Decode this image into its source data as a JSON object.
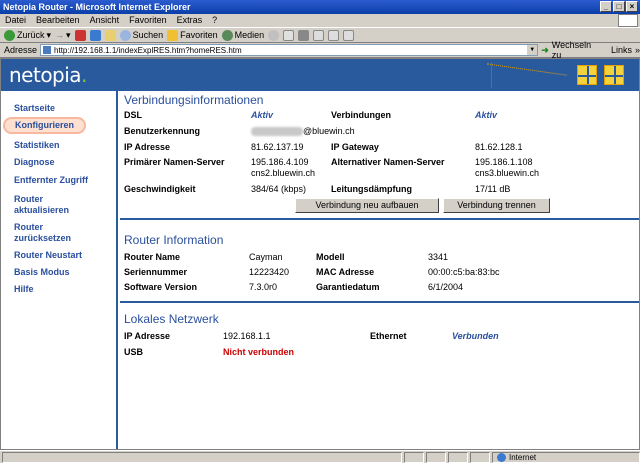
{
  "window": {
    "title": "Netopia Router - Microsoft Internet Explorer"
  },
  "menu": [
    "Datei",
    "Bearbeiten",
    "Ansicht",
    "Favoriten",
    "Extras",
    "?"
  ],
  "toolbar": {
    "back": "Zurück",
    "search": "Suchen",
    "favorites": "Favoriten",
    "media": "Medien"
  },
  "address": {
    "label": "Adresse",
    "url": "http://192.168.1.1/indexExplRES.htm?homeRES.htm",
    "go": "Wechseln zu",
    "links": "Links"
  },
  "brand": {
    "logo": "netopia",
    "logo_dot": "."
  },
  "sidebar": {
    "items": [
      {
        "label": "Startseite"
      },
      {
        "label": "Konfigurieren"
      },
      {
        "label": "Statistiken"
      },
      {
        "label": "Diagnose"
      },
      {
        "label": "Entfernter Zugriff"
      },
      {
        "label": "Router aktualisieren"
      },
      {
        "label": "Router zurücksetzen"
      },
      {
        "label": "Router Neustart"
      },
      {
        "label": "Basis Modus"
      },
      {
        "label": "Hilfe"
      }
    ]
  },
  "connection": {
    "title": "Verbindungsinformationen",
    "dsl_label": "DSL",
    "dsl_value": "Aktiv",
    "conn_label": "Verbindungen",
    "conn_value": "Aktiv",
    "user_label": "Benutzerkennung",
    "user_value": "@bluewin.ch",
    "ip_label": "IP Adresse",
    "ip_value": "81.62.137.19",
    "gw_label": "IP Gateway",
    "gw_value": "81.62.128.1",
    "dns1_label": "Primärer Namen-Server",
    "dns1_ip": "195.186.4.109",
    "dns1_host": "cns2.bluewin.ch",
    "dns2_label": "Alternativer Namen-Server",
    "dns2_ip": "195.186.1.108",
    "dns2_host": "cns3.bluewin.ch",
    "speed_label": "Geschwindigkeit",
    "speed_value": "384/64 (kbps)",
    "att_label": "Leitungsdämpfung",
    "att_value": "17/11 dB",
    "btn_reconnect": "Verbindung neu aufbauen",
    "btn_disconnect": "Verbindung trennen"
  },
  "router": {
    "title": "Router Information",
    "name_label": "Router Name",
    "name_value": "Cayman",
    "model_label": "Modell",
    "model_value": "3341",
    "serial_label": "Seriennummer",
    "serial_value": "12223420",
    "mac_label": "MAC Adresse",
    "mac_value": "00:00:c5:ba:83:bc",
    "sw_label": "Software Version",
    "sw_value": "7.3.0r0",
    "warranty_label": "Garantiedatum",
    "warranty_value": "6/1/2004"
  },
  "lan": {
    "title": "Lokales Netzwerk",
    "ip_label": "IP Adresse",
    "ip_value": "192.168.1.1",
    "eth_label": "Ethernet",
    "eth_value": "Verbunden",
    "usb_label": "USB",
    "usb_value": "Nicht verbunden"
  },
  "status": {
    "zone": "Internet"
  },
  "colors": {
    "accent": "#2a5a9e",
    "link": "#2a4f9c",
    "error": "#cc0000",
    "highlight": "#fde0d0"
  }
}
